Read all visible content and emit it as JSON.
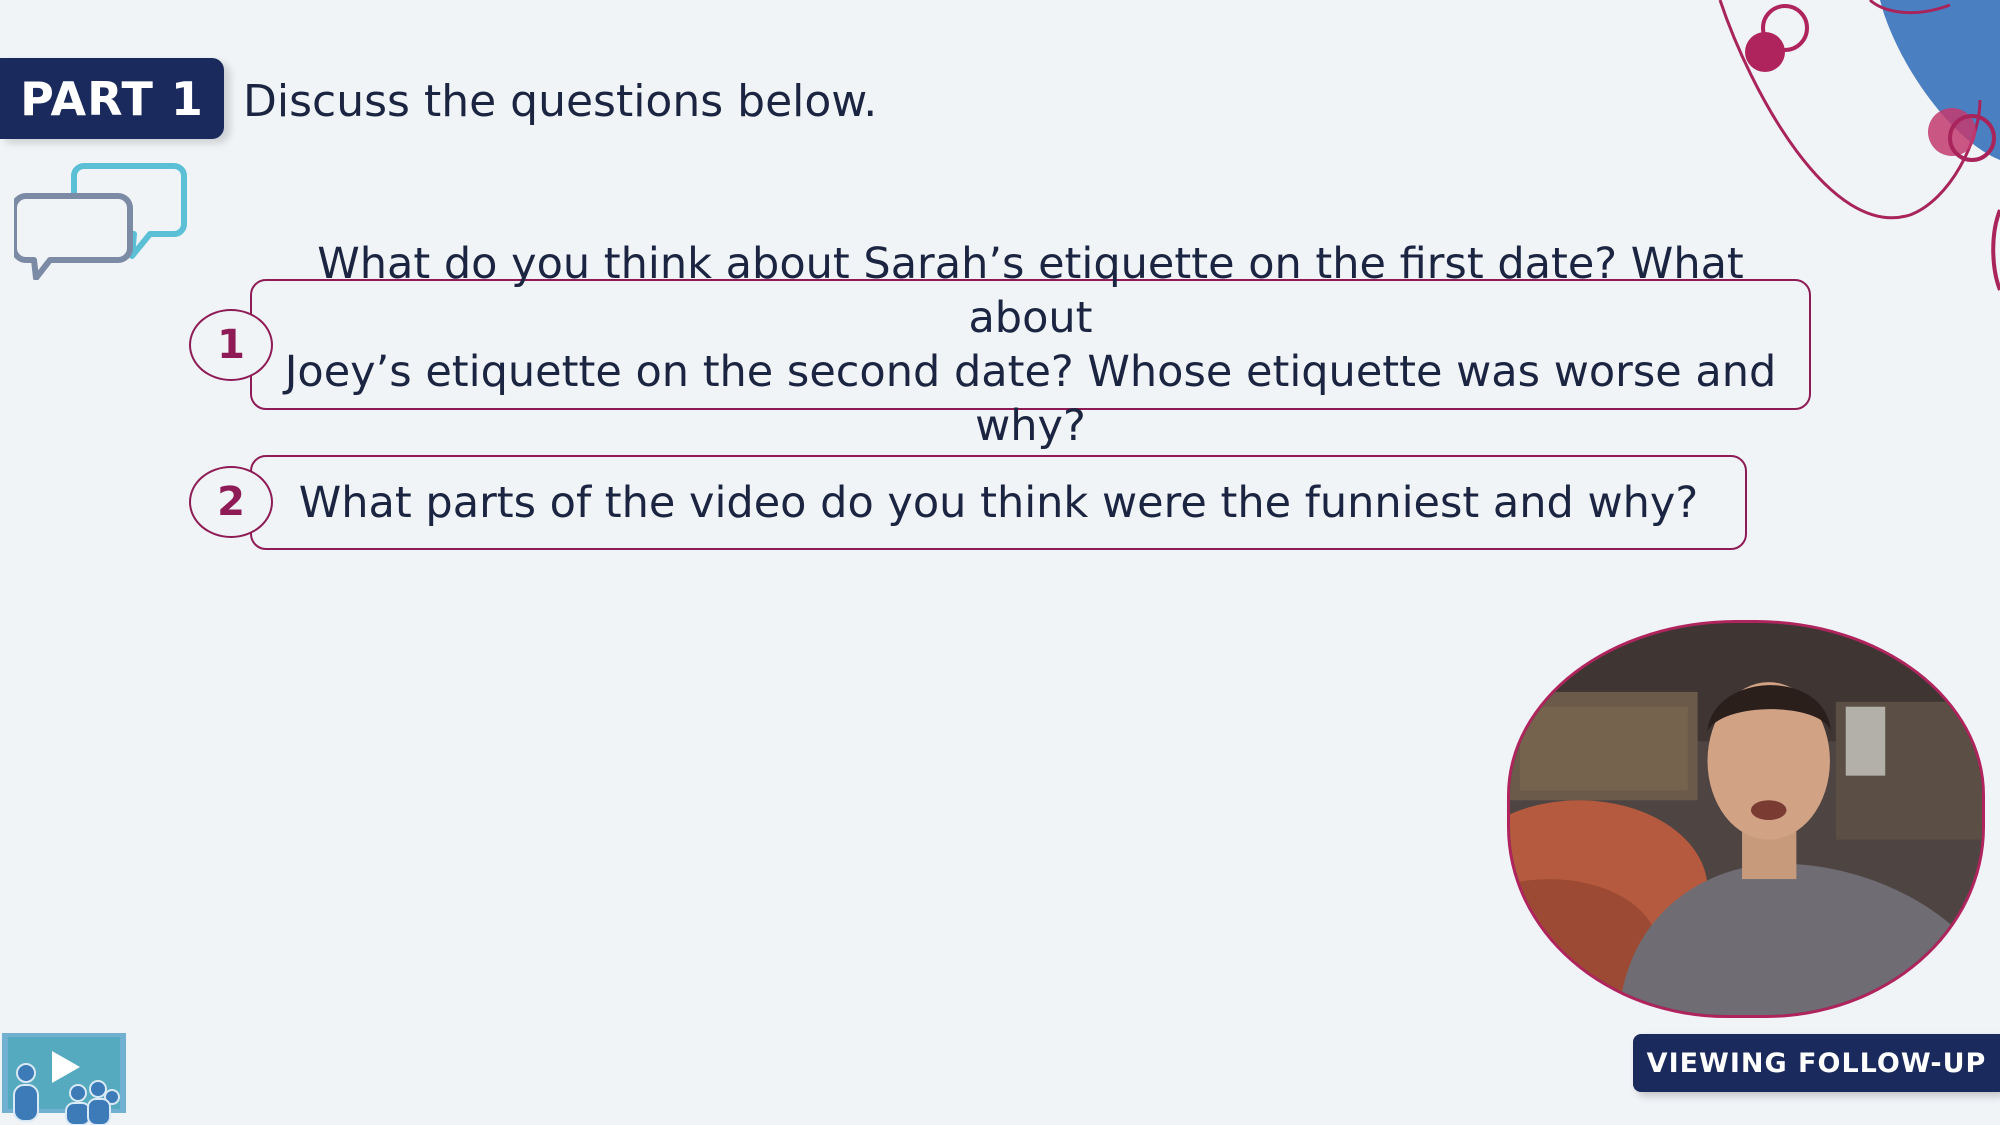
{
  "header": {
    "part_label": "PART 1",
    "instruction": "Discuss the questions below."
  },
  "questions": [
    {
      "number": "1",
      "lines": [
        "What do you think about Sarah’s etiquette on the first date? What about",
        "Joey’s etiquette on the second date? Whose etiquette was worse and why?"
      ]
    },
    {
      "number": "2",
      "lines": [
        "What parts of the video do you think were the funniest and why?"
      ]
    }
  ],
  "footer": {
    "section_label": "VIEWING FOLLOW-UP"
  },
  "icons": {
    "chat": "chat-bubbles-icon",
    "video_class": "video-class-icon"
  },
  "colors": {
    "navy": "#1a2a5c",
    "accent_magenta": "#8e1b55",
    "background": "#f0f4f7",
    "decor_blue": "#4a7fc1"
  }
}
